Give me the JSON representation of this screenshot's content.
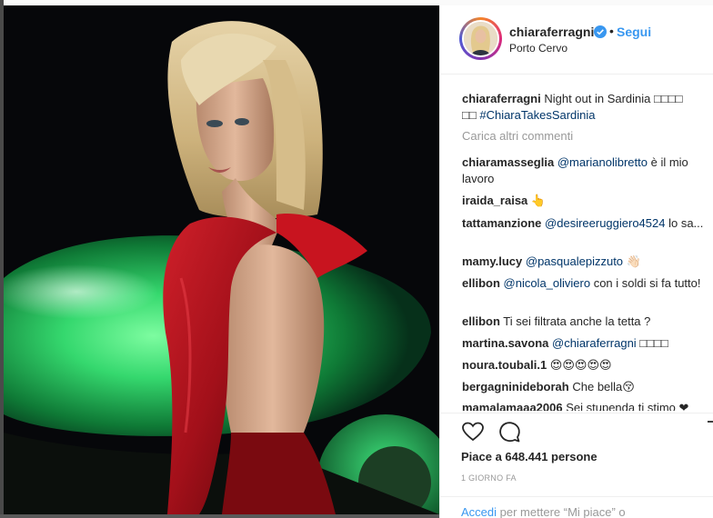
{
  "post": {
    "username": "chiaraferragni",
    "follow_label": "Segui",
    "location": "Porto Cervo",
    "caption_user": "chiaraferragni",
    "caption_text_line1": "Night out in Sardinia □□□□",
    "caption_text_line2_prefix": "□□",
    "caption_hashtag": "#ChiaraTakesSardinia",
    "load_more": "Carica altri commenti",
    "likes": "Piace a 648.441 persone",
    "time": "1 GIORNO FA",
    "login_link": "Accedi",
    "login_rest": "per mettere “Mi piace” o"
  },
  "comments": [
    {
      "user": "chiaramasseglia",
      "mention": "@marianolibretto",
      "text": " è il mio lavoro"
    },
    {
      "user": "iraida_raisa",
      "mention": "",
      "text": "👆"
    },
    {
      "user": "tattamanzione",
      "mention": "@desireeruggiero4524",
      "text": " lo sa..."
    },
    {
      "user": "mamy.lucy",
      "mention": "@pasqualepizzuto",
      "text": " 👋🏻"
    },
    {
      "user": "ellibon",
      "mention": "@nicola_oliviero",
      "text": " con i soldi si fa tutto!"
    },
    {
      "user": "ellibon",
      "mention": "",
      "text": "Ti sei filtrata anche la tetta ?"
    },
    {
      "user": "martina.savona",
      "mention": "@chiaraferragni",
      "text": " □□□□"
    },
    {
      "user": "noura.toubali.1",
      "mention": "",
      "text": "😍😍😍😍😍"
    },
    {
      "user": "bergagninideborah",
      "mention": "",
      "text": "Che bella😚"
    },
    {
      "user": "mamalamaaa2006",
      "mention": "",
      "text": "Sei stupenda ti stimo ❤"
    }
  ],
  "icons": {
    "verified": "verified-badge-icon",
    "like": "heart-icon",
    "comment": "comment-icon",
    "save": "bookmark-icon"
  },
  "colors": {
    "link_blue": "#3897f0",
    "mention_blue": "#003569",
    "dress_red": "#b0121a",
    "pool_green": "#2fd36a"
  }
}
